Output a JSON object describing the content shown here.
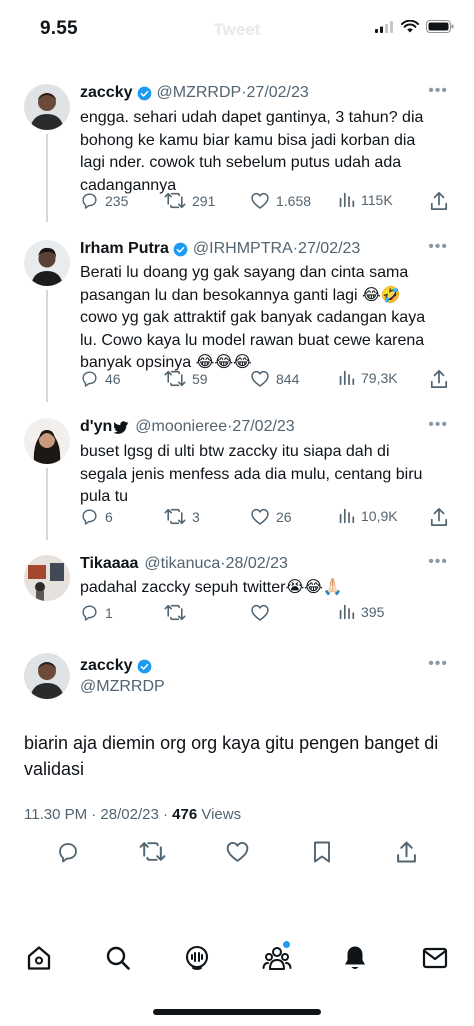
{
  "status_bar": {
    "time": "9.55"
  },
  "header": {
    "title": "Tweet"
  },
  "replies": [
    {
      "name": "zaccky",
      "verified": true,
      "handle": "@MZRRDP",
      "date": "27/02/23",
      "lines": [
        "engga. sehari udah dapet gantinya, 3 tahun? dia",
        "bohong ke kamu biar kamu bisa jadi korban dia",
        "lagi nder. cowok tuh sebelum putus udah ada",
        "cadangannya"
      ],
      "replies": "235",
      "retweets": "291",
      "likes": "1.658",
      "views": "115K"
    },
    {
      "name": "Irham Putra",
      "verified": true,
      "handle": "@IRHMPTRA",
      "date": "27/02/23",
      "lines": [
        "Berati lu doang yg gak sayang dan cinta sama",
        "pasangan lu dan besokannya ganti lagi 😂🤣",
        "cowo yg gak attraktif gak banyak cadangan kaya",
        "lu. Cowo kaya lu model rawan buat cewe karena",
        "banyak opsinya 😂😂😂"
      ],
      "replies": "46",
      "retweets": "59",
      "likes": "844",
      "views": "79,3K"
    },
    {
      "name": "d'yn",
      "verified": false,
      "handle": "@moonieree",
      "date": "27/02/23",
      "lines": [
        "buset lgsg di ulti btw zaccky itu siapa dah di",
        "segala jenis menfess ada dia mulu, centang biru",
        "pula tu"
      ],
      "replies": "6",
      "retweets": "3",
      "likes": "26",
      "views": "10,9K"
    },
    {
      "name": "Tikaaaa",
      "verified": false,
      "handle": "@tikanuca",
      "date": "28/02/23",
      "lines": [
        "padahal zaccky sepuh twitter😭😂🙏🏻"
      ],
      "replies": "1",
      "retweets": "",
      "likes": "",
      "views": "395"
    }
  ],
  "main_tweet": {
    "name": "zaccky",
    "handle": "@MZRRDP",
    "lines": [
      "biarin aja diemin org org kaya gitu pengen banget di",
      "validasi"
    ],
    "time": "11.30 PM · 28/02/23 · ",
    "views_count": "476",
    "views_label": " Views"
  },
  "icons": {
    "reply": "reply-icon",
    "retweet": "retweet-icon",
    "like": "heart-icon",
    "views": "views-icon",
    "share": "share-icon",
    "bookmark": "bookmark-icon",
    "more": "more-icon",
    "verified": "verified-badge-icon",
    "nav": [
      "home-icon",
      "search-icon",
      "spaces-icon",
      "communities-icon",
      "notifications-icon",
      "messages-icon"
    ]
  },
  "colors": {
    "accent": "#1d9bf0",
    "text": "#0f1419",
    "muted": "#536471"
  }
}
